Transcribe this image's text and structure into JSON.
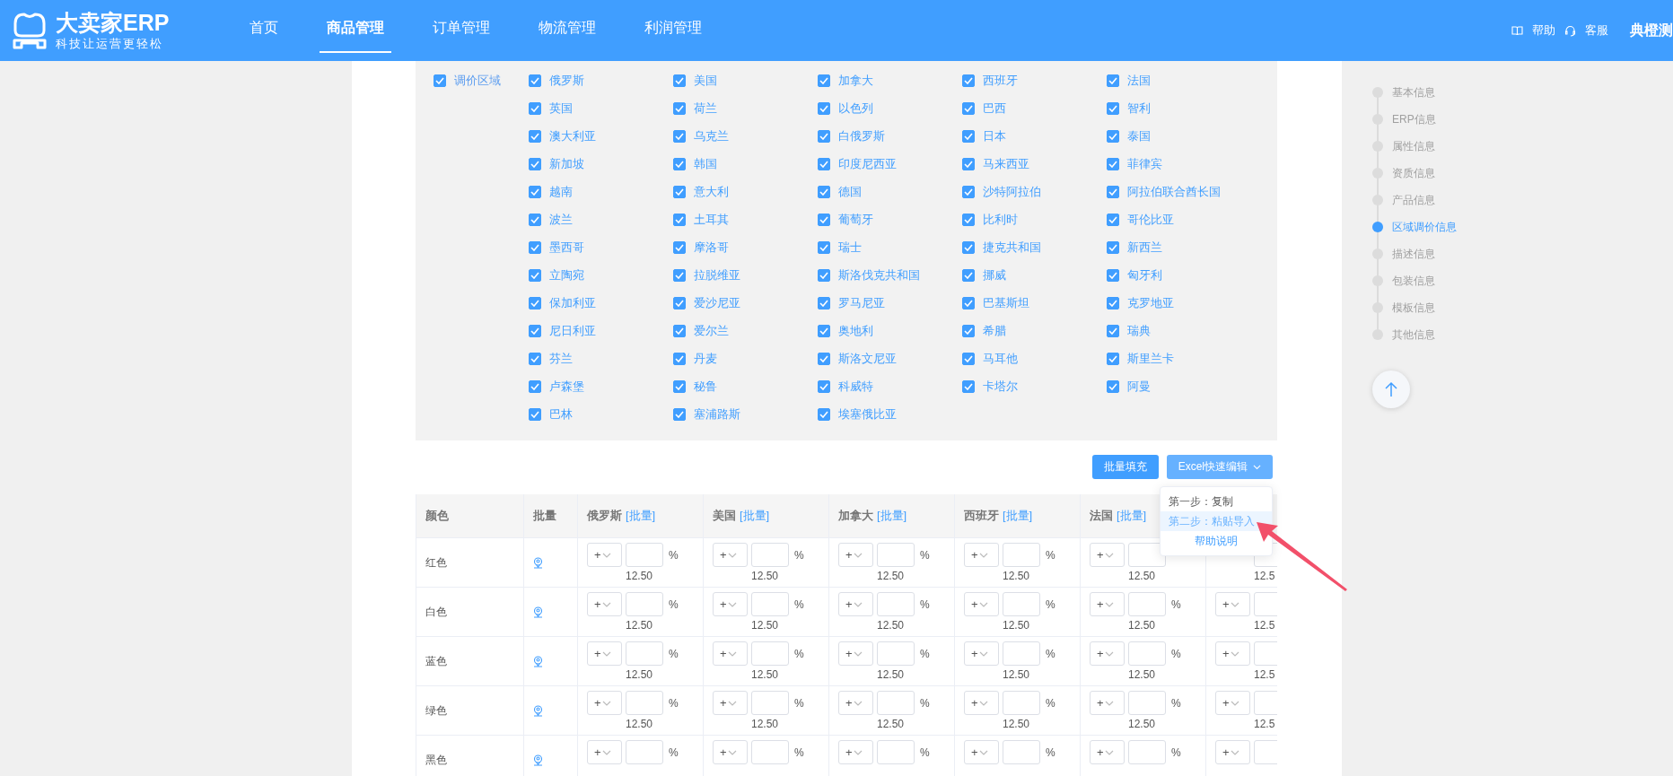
{
  "header": {
    "logo": {
      "title": "大卖家ERP",
      "slogan": "科技让运营更轻松"
    },
    "nav": [
      {
        "label": "首页",
        "selected": false
      },
      {
        "label": "商品管理",
        "selected": true
      },
      {
        "label": "订单管理",
        "selected": false
      },
      {
        "label": "物流管理",
        "selected": false
      },
      {
        "label": "利润管理",
        "selected": false
      }
    ],
    "links": [
      {
        "label": "帮助",
        "kind": "book"
      },
      {
        "label": "客服",
        "kind": "headset"
      }
    ],
    "user": "典橙测"
  },
  "region_panel": {
    "master": {
      "label": "调价区域",
      "checked": true
    },
    "countries": [
      {
        "label": "俄罗斯",
        "checked": true
      },
      {
        "label": "美国",
        "checked": true
      },
      {
        "label": "加拿大",
        "checked": true
      },
      {
        "label": "西班牙",
        "checked": true
      },
      {
        "label": "法国",
        "checked": true
      },
      {
        "label": "英国",
        "checked": true
      },
      {
        "label": "荷兰",
        "checked": true
      },
      {
        "label": "以色列",
        "checked": true
      },
      {
        "label": "巴西",
        "checked": true
      },
      {
        "label": "智利",
        "checked": true
      },
      {
        "label": "澳大利亚",
        "checked": true
      },
      {
        "label": "乌克兰",
        "checked": true
      },
      {
        "label": "白俄罗斯",
        "checked": true
      },
      {
        "label": "日本",
        "checked": true
      },
      {
        "label": "泰国",
        "checked": true
      },
      {
        "label": "新加坡",
        "checked": true
      },
      {
        "label": "韩国",
        "checked": true
      },
      {
        "label": "印度尼西亚",
        "checked": true
      },
      {
        "label": "马来西亚",
        "checked": true
      },
      {
        "label": "菲律宾",
        "checked": true
      },
      {
        "label": "越南",
        "checked": true
      },
      {
        "label": "意大利",
        "checked": true
      },
      {
        "label": "德国",
        "checked": true
      },
      {
        "label": "沙特阿拉伯",
        "checked": true
      },
      {
        "label": "阿拉伯联合酋长国",
        "checked": true
      },
      {
        "label": "波兰",
        "checked": true
      },
      {
        "label": "土耳其",
        "checked": true
      },
      {
        "label": "葡萄牙",
        "checked": true
      },
      {
        "label": "比利时",
        "checked": true
      },
      {
        "label": "哥伦比亚",
        "checked": true
      },
      {
        "label": "墨西哥",
        "checked": true
      },
      {
        "label": "摩洛哥",
        "checked": true
      },
      {
        "label": "瑞士",
        "checked": true
      },
      {
        "label": "捷克共和国",
        "checked": true
      },
      {
        "label": "新西兰",
        "checked": true
      },
      {
        "label": "立陶宛",
        "checked": true
      },
      {
        "label": "拉脱维亚",
        "checked": true
      },
      {
        "label": "斯洛伐克共和国",
        "checked": true
      },
      {
        "label": "挪威",
        "checked": true
      },
      {
        "label": "匈牙利",
        "checked": true
      },
      {
        "label": "保加利亚",
        "checked": true
      },
      {
        "label": "爱沙尼亚",
        "checked": true
      },
      {
        "label": "罗马尼亚",
        "checked": true
      },
      {
        "label": "巴基斯坦",
        "checked": true
      },
      {
        "label": "克罗地亚",
        "checked": true
      },
      {
        "label": "尼日利亚",
        "checked": true
      },
      {
        "label": "爱尔兰",
        "checked": true
      },
      {
        "label": "奥地利",
        "checked": true
      },
      {
        "label": "希腊",
        "checked": true
      },
      {
        "label": "瑞典",
        "checked": true
      },
      {
        "label": "芬兰",
        "checked": true
      },
      {
        "label": "丹麦",
        "checked": true
      },
      {
        "label": "斯洛文尼亚",
        "checked": true
      },
      {
        "label": "马耳他",
        "checked": true
      },
      {
        "label": "斯里兰卡",
        "checked": true
      },
      {
        "label": "卢森堡",
        "checked": true
      },
      {
        "label": "秘鲁",
        "checked": true
      },
      {
        "label": "科威特",
        "checked": true
      },
      {
        "label": "卡塔尔",
        "checked": true
      },
      {
        "label": "阿曼",
        "checked": true
      },
      {
        "label": "巴林",
        "checked": true
      },
      {
        "label": "塞浦路斯",
        "checked": true
      },
      {
        "label": "埃塞俄比亚",
        "checked": true
      }
    ]
  },
  "toolbar": {
    "buttons": [
      {
        "label": "批量填充",
        "kind": "primary"
      },
      {
        "label": "Excel快速编辑",
        "kind": "dropdown"
      }
    ],
    "menu": [
      {
        "label": "第一步：复制",
        "selected": false
      },
      {
        "label": "第二步：粘贴导入",
        "selected": true
      },
      {
        "label": "帮助说明",
        "selected": false,
        "kind": "link"
      }
    ]
  },
  "table": {
    "columns": [
      {
        "label": "颜色"
      },
      {
        "label": "批量"
      },
      {
        "label": "俄罗斯",
        "link": "[批量]"
      },
      {
        "label": "美国",
        "link": "[批量]"
      },
      {
        "label": "加拿大",
        "link": "[批量]"
      },
      {
        "label": "西班牙",
        "link": "[批量]"
      },
      {
        "label": "法国",
        "link": "[批量]"
      }
    ],
    "rows": [
      {
        "cells": [
          {
            "kind": "text",
            "text": "红色"
          },
          {
            "kind": "batch"
          },
          {
            "kind": "price",
            "sign": "+",
            "unit": "%",
            "value": "12.50"
          },
          {
            "kind": "price",
            "sign": "+",
            "unit": "%",
            "value": "12.50"
          },
          {
            "kind": "price",
            "sign": "+",
            "unit": "%",
            "value": "12.50"
          },
          {
            "kind": "price",
            "sign": "+",
            "unit": "%",
            "value": "12.50"
          },
          {
            "kind": "price",
            "sign": "+",
            "value": "12.50"
          },
          {
            "kind": "price",
            "value": "12.5"
          }
        ]
      },
      {
        "cells": [
          {
            "kind": "text",
            "text": "白色"
          },
          {
            "kind": "batch"
          },
          {
            "kind": "price",
            "sign": "+",
            "unit": "%",
            "value": "12.50"
          },
          {
            "kind": "price",
            "sign": "+",
            "unit": "%",
            "value": "12.50"
          },
          {
            "kind": "price",
            "sign": "+",
            "unit": "%",
            "value": "12.50"
          },
          {
            "kind": "price",
            "sign": "+",
            "unit": "%",
            "value": "12.50"
          },
          {
            "kind": "price",
            "sign": "+",
            "unit": "%",
            "value": "12.50"
          },
          {
            "kind": "price",
            "sign": "+",
            "value": "12.5"
          }
        ]
      },
      {
        "cells": [
          {
            "kind": "text",
            "text": "蓝色"
          },
          {
            "kind": "batch"
          },
          {
            "kind": "price",
            "sign": "+",
            "unit": "%",
            "value": "12.50"
          },
          {
            "kind": "price",
            "sign": "+",
            "unit": "%",
            "value": "12.50"
          },
          {
            "kind": "price",
            "sign": "+",
            "unit": "%",
            "value": "12.50"
          },
          {
            "kind": "price",
            "sign": "+",
            "unit": "%",
            "value": "12.50"
          },
          {
            "kind": "price",
            "sign": "+",
            "unit": "%",
            "value": "12.50"
          },
          {
            "kind": "price",
            "sign": "+",
            "value": "12.5"
          }
        ]
      },
      {
        "cells": [
          {
            "kind": "text",
            "text": "绿色"
          },
          {
            "kind": "batch"
          },
          {
            "kind": "price",
            "sign": "+",
            "unit": "%",
            "value": "12.50"
          },
          {
            "kind": "price",
            "sign": "+",
            "unit": "%",
            "value": "12.50"
          },
          {
            "kind": "price",
            "sign": "+",
            "unit": "%",
            "value": "12.50"
          },
          {
            "kind": "price",
            "sign": "+",
            "unit": "%",
            "value": "12.50"
          },
          {
            "kind": "price",
            "sign": "+",
            "unit": "%",
            "value": "12.50"
          },
          {
            "kind": "price",
            "sign": "+",
            "value": "12.5"
          }
        ]
      },
      {
        "cells": [
          {
            "kind": "text",
            "text": "黑色"
          },
          {
            "kind": "batch"
          },
          {
            "kind": "price",
            "sign": "+",
            "unit": "%"
          },
          {
            "kind": "price",
            "sign": "+",
            "unit": "%"
          },
          {
            "kind": "price",
            "sign": "+",
            "unit": "%"
          },
          {
            "kind": "price",
            "sign": "+",
            "unit": "%"
          },
          {
            "kind": "price",
            "sign": "+",
            "unit": "%"
          },
          {
            "kind": "price",
            "sign": "+"
          }
        ]
      }
    ]
  },
  "outline": {
    "items": [
      {
        "label": "基本信息",
        "selected": false
      },
      {
        "label": "ERP信息",
        "selected": false
      },
      {
        "label": "属性信息",
        "selected": false
      },
      {
        "label": "资质信息",
        "selected": false
      },
      {
        "label": "产品信息",
        "selected": false
      },
      {
        "label": "区域调价信息",
        "selected": true
      },
      {
        "label": "描述信息",
        "selected": false
      },
      {
        "label": "包装信息",
        "selected": false
      },
      {
        "label": "模板信息",
        "selected": false
      },
      {
        "label": "其他信息",
        "selected": false
      }
    ]
  }
}
